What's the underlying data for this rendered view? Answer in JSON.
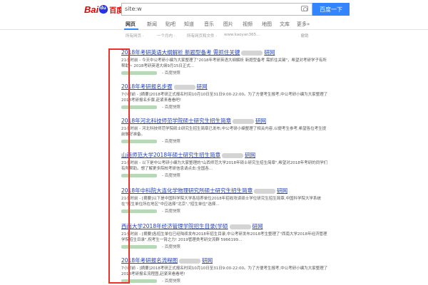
{
  "header": {
    "logo_left": "Bai",
    "logo_right": "百度",
    "search_value": "site:w",
    "search_button": "百度一下"
  },
  "tabs": [
    {
      "label": "网页",
      "active": true
    },
    {
      "label": "新闻",
      "active": false
    },
    {
      "label": "贴吧",
      "active": false
    },
    {
      "label": "知道",
      "active": false
    },
    {
      "label": "音乐",
      "active": false
    },
    {
      "label": "图片",
      "active": false
    },
    {
      "label": "视频",
      "active": false
    },
    {
      "label": "地图",
      "active": false
    },
    {
      "label": "文库",
      "active": false
    },
    {
      "label": "更多»",
      "active": false
    }
  ],
  "tools": {
    "time": "所有网页 ·",
    "range": "一个月内 ·",
    "filetype": "所有网页和文件 ·",
    "site": "www.kaoyan365...",
    "help": "· 撤销"
  },
  "results": [
    {
      "title_a": "2018年考研英语大纲解析 新题型备考 需抓住关键",
      "title_b": "研网",
      "snippet": "21小时前 - 今天中公考研小编为大家整理了\"2018年考研英语大纲解析 新题型备考 需抓住关键\"，希望对考研学子有所帮助~ 2018考研英语大纲9月15日正式...",
      "url_tail": "- 百度快照"
    },
    {
      "title_a": "2018年考研报名步骤",
      "title_b": "研网",
      "snippet": "7小时前 - [摘要]2018考研正式报名时间10月10日至31日9:00-22:00。为了方便考生报考,中公考研小编为大家整理了2018考研报名步骤,赶紧来看看吧!",
      "url_tail": "- 百度快照"
    },
    {
      "title_a": "2018年河北科技师范学院硕士研究生招生简章",
      "title_b": "研网",
      "snippet": "21小时前 - 河北科技师范学院硕士研究生招生简章已发布,中公考研小编整理了相关内容,以便考生参考,希望各位考生提前做好准备。",
      "url_tail": "- 百度快照"
    },
    {
      "title_a": "山西师范大学2018年硕士研究生招生简章",
      "title_b": "研网",
      "snippet": "21小时前 - 以下是中公考研小编为大家整理的\"山西师范大学2018年硕士研究生招生简章\",希望对2018年考研的同学们有所帮助。想了解更多院校考研信息请点击:全国各...",
      "url_tail": "- 百度快照"
    },
    {
      "title_a": "2018年中科院大连化学物理研究所硕士研究生招生简章",
      "title_b": "研网",
      "snippet": "21小时前 - [摘要]以下是中国科学院大学各培养单位2018年招收攻读硕士学位研究生招生简章,中国科学院大学系统在\"招生单位所在地区\"中应选择\"北京\",\"招生单位\"选择...",
      "url_tail": "- 百度快照"
    },
    {
      "title_a": "西南大学2018年经济管理学院招生目录(学硕",
      "title_b": "研网",
      "snippet": "21小时前 - [摘要]各招生单位已经陆续发布2018年招生目录,中公考研发布2018考生整理了\"西南大学2018年经济管理学院招生目录\",祝考生一臂之力! 2019管理类考研交流群 5966199...",
      "url_tail": "- 百度快照"
    },
    {
      "title_a": "2018年考研报名流程图",
      "title_b": "研网",
      "snippet": "7小时前 - [摘要]2018考研正式报名时间10月10日至31日9:00-22:00。为了方便考生报考,中公考研小编为大家整理了2018考研报名流程图,赶紧来看看吧!",
      "url_tail": "- 百度快照"
    }
  ],
  "colors": {
    "accent": "#3385ff",
    "title_link": "#2440b3",
    "url_green": "#008000",
    "highlight": "#e8342a"
  }
}
